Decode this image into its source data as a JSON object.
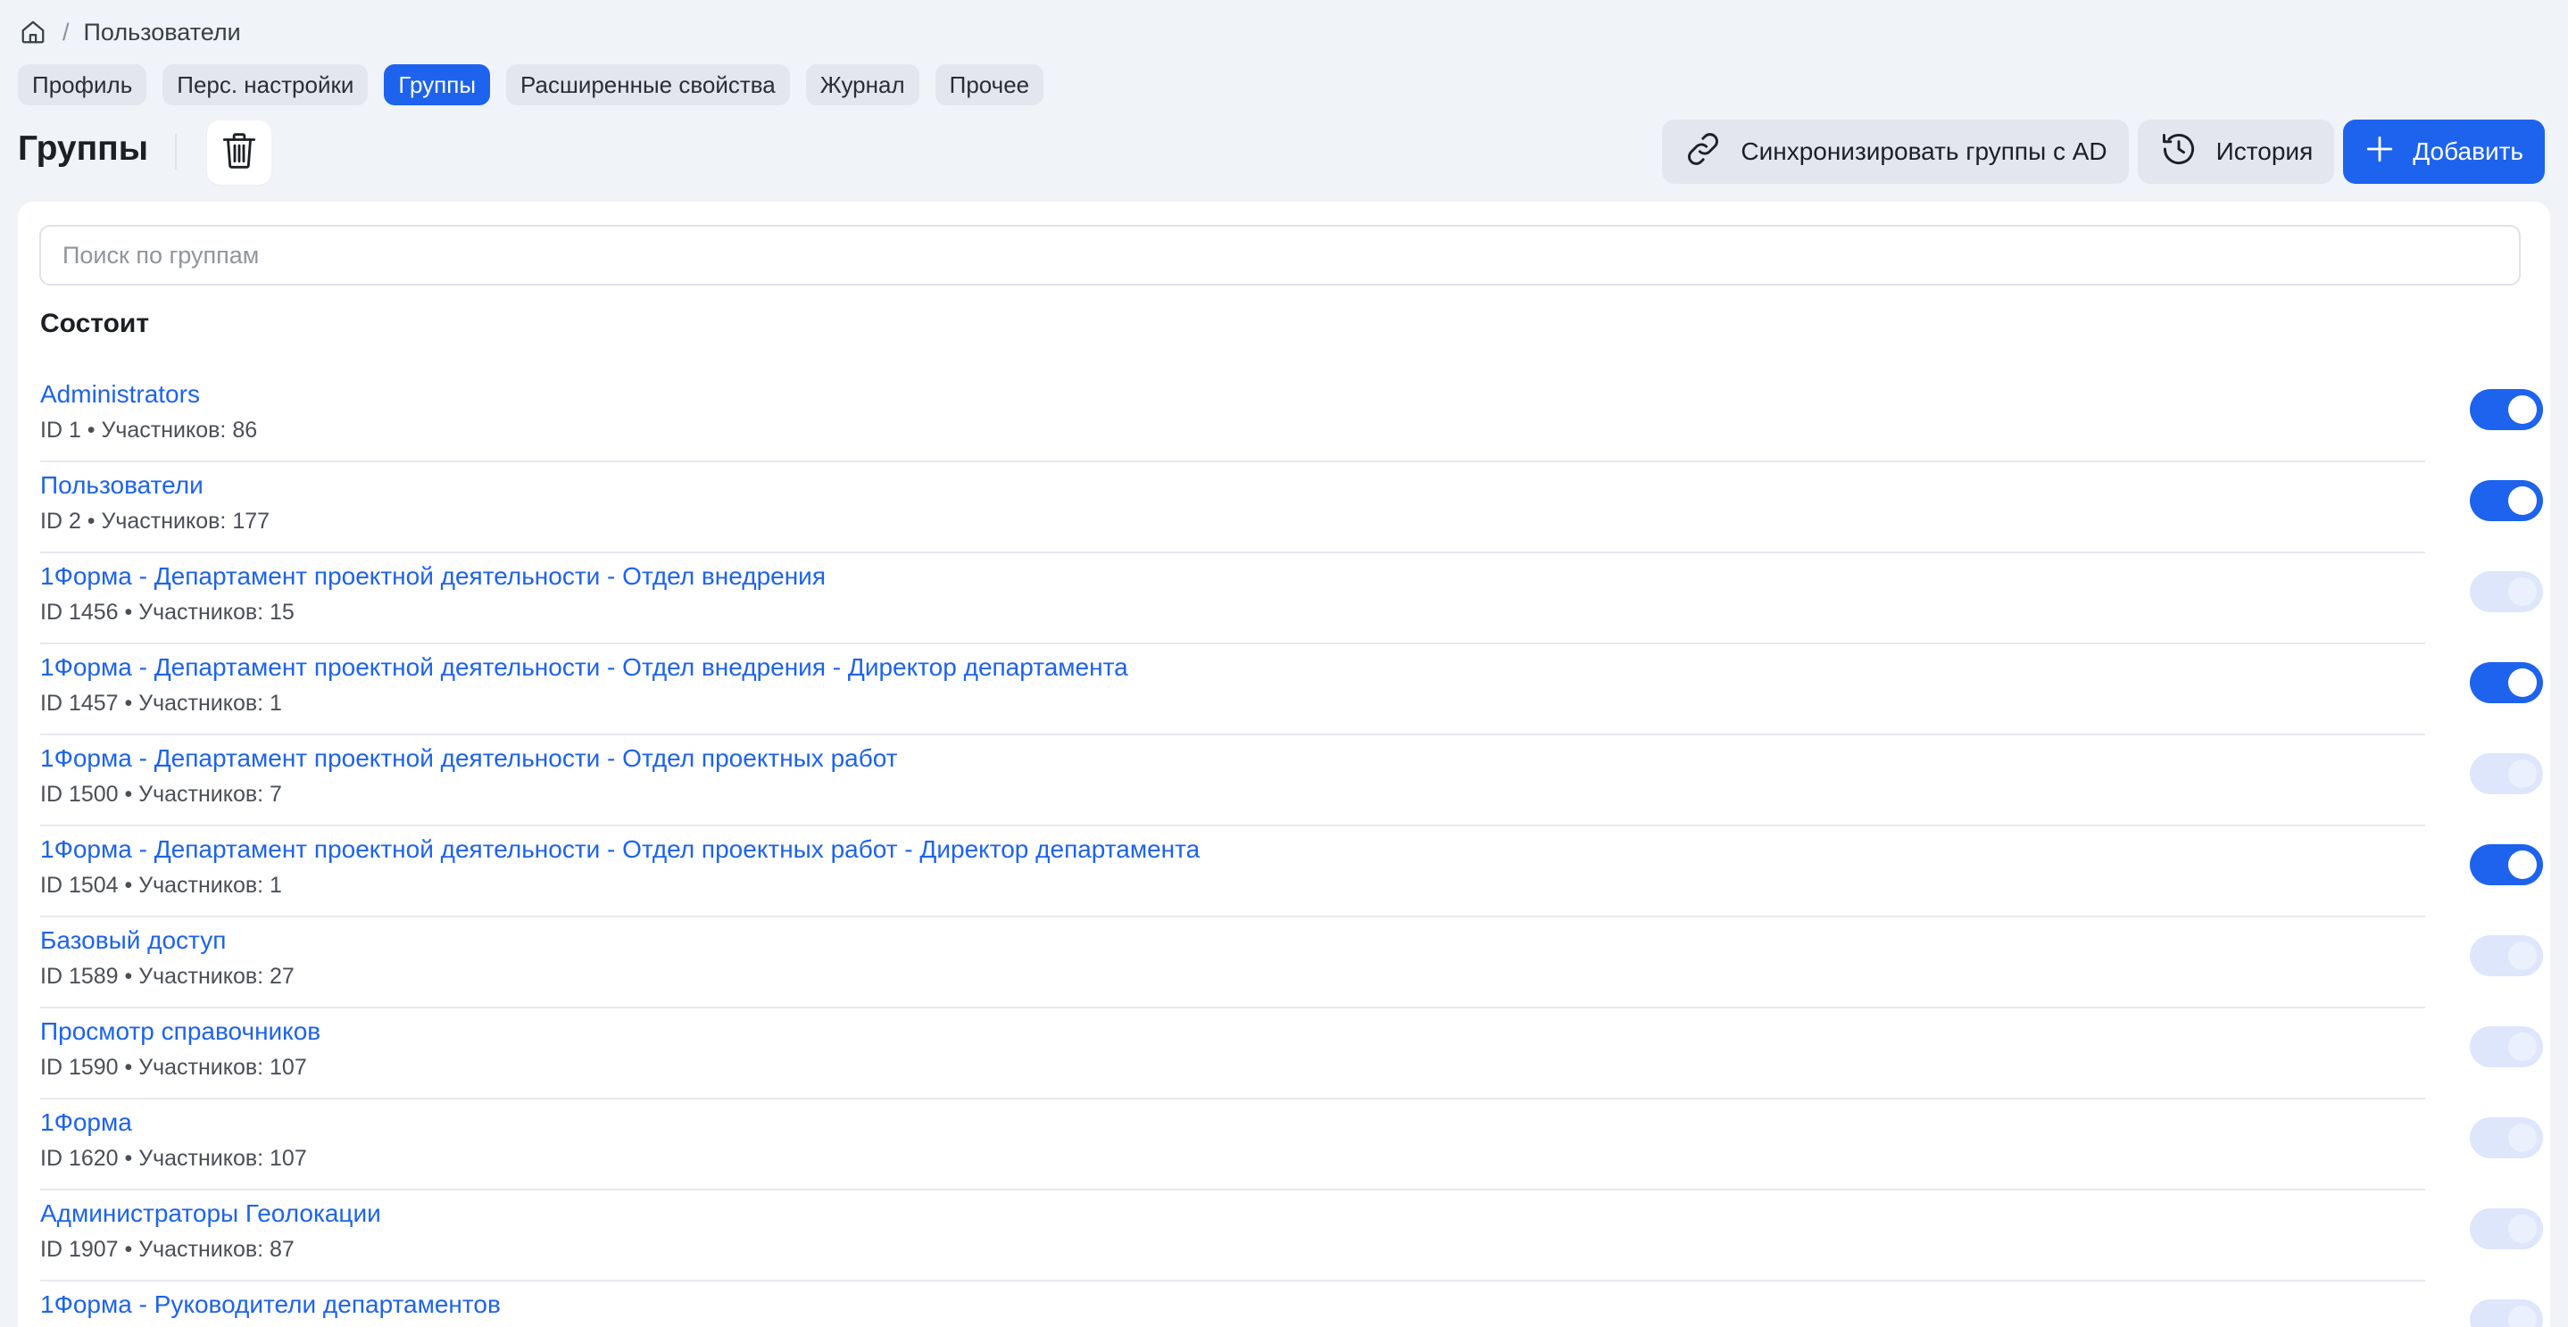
{
  "breadcrumb": {
    "separator": "/",
    "current": "Пользователи"
  },
  "tabs": [
    {
      "label": "Профиль",
      "active": false
    },
    {
      "label": "Перс. настройки",
      "active": false
    },
    {
      "label": "Группы",
      "active": true
    },
    {
      "label": "Расширенные свойства",
      "active": false
    },
    {
      "label": "Журнал",
      "active": false
    },
    {
      "label": "Прочее",
      "active": false
    }
  ],
  "page": {
    "title": "Группы",
    "sync_label": "Синхронизировать группы с AD",
    "history_label": "История",
    "add_label": "Добавить"
  },
  "search": {
    "placeholder": "Поиск по группам",
    "value": ""
  },
  "section": {
    "title": "Состоит"
  },
  "groups": [
    {
      "name": "Administrators",
      "meta": "ID 1 • Участников: 86",
      "enabled": true
    },
    {
      "name": "Пользователи",
      "meta": "ID 2 • Участников: 177",
      "enabled": true
    },
    {
      "name": "1Форма - Департамент проектной деятельности - Отдел внедрения",
      "meta": "ID 1456 • Участников: 15",
      "enabled": false
    },
    {
      "name": "1Форма - Департамент проектной деятельности - Отдел внедрения - Директор департамента",
      "meta": "ID 1457 • Участников: 1",
      "enabled": true
    },
    {
      "name": "1Форма - Департамент проектной деятельности - Отдел проектных работ",
      "meta": "ID 1500 • Участников: 7",
      "enabled": false
    },
    {
      "name": "1Форма - Департамент проектной деятельности - Отдел проектных работ - Директор департамента",
      "meta": "ID 1504 • Участников: 1",
      "enabled": true
    },
    {
      "name": "Базовый доступ",
      "meta": "ID 1589 • Участников: 27",
      "enabled": false
    },
    {
      "name": "Просмотр справочников",
      "meta": "ID 1590 • Участников: 107",
      "enabled": false
    },
    {
      "name": "1Форма",
      "meta": "ID 1620 • Участников: 107",
      "enabled": false
    },
    {
      "name": "Администраторы Геолокации",
      "meta": "ID 1907 • Участников: 87",
      "enabled": false
    },
    {
      "name": "1Форма - Руководители департаментов",
      "meta": "",
      "enabled": false
    }
  ],
  "colors": {
    "accent": "#1d63ed",
    "toggle_off": "#dde6fb",
    "background": "#f0f3f7"
  },
  "icons": {
    "home": "home-icon",
    "trash": "trash-icon",
    "link": "link-icon",
    "history": "history-icon",
    "plus": "plus-icon"
  }
}
